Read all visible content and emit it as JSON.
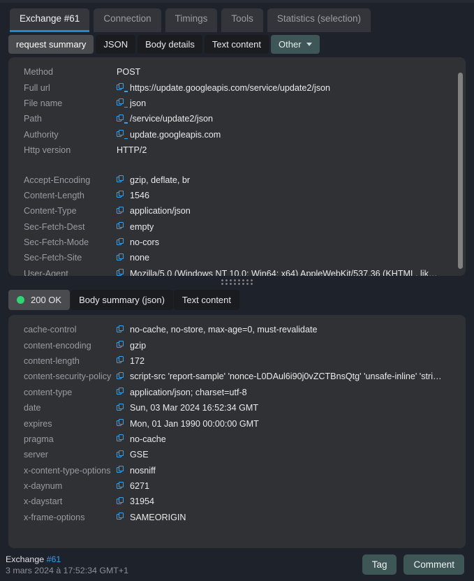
{
  "colors": {
    "background": "#1e232b",
    "panel": "#303134",
    "accent_blue": "#1f8ad0",
    "link_blue": "#3aa0e8",
    "teal_button": "#3e5656",
    "status_green": "#2fd573",
    "label_gray": "#9a9ca1"
  },
  "main_tabs": [
    {
      "label": "Exchange #61",
      "active": true
    },
    {
      "label": "Connection",
      "active": false
    },
    {
      "label": "Timings",
      "active": false
    },
    {
      "label": "Tools",
      "active": false
    },
    {
      "label": "Statistics (selection)",
      "active": false
    }
  ],
  "request_subtabs": [
    {
      "label": "request summary",
      "active": true
    },
    {
      "label": "JSON",
      "active": false
    },
    {
      "label": "Body details",
      "active": false
    },
    {
      "label": "Text content",
      "active": false
    }
  ],
  "request_other_dropdown": {
    "label": "Other",
    "icon": "chevron-down-icon"
  },
  "request_summary": {
    "groups": [
      {
        "rows": [
          {
            "key": "Method",
            "value": "POST",
            "copy": false,
            "link": false
          },
          {
            "key": "Full url",
            "value": "https://update.googleapis.com/service/update2/json",
            "copy": true,
            "link": true
          },
          {
            "key": "File name",
            "value": "json",
            "copy": true,
            "link": true
          },
          {
            "key": "Path",
            "value": "/service/update2/json",
            "copy": true,
            "link": true
          },
          {
            "key": "Authority",
            "value": "update.googleapis.com",
            "copy": true,
            "link": true
          },
          {
            "key": "Http version",
            "value": "HTTP/2",
            "copy": false,
            "link": false
          }
        ]
      },
      {
        "rows": [
          {
            "key": "Accept-Encoding",
            "value": "gzip, deflate, br",
            "copy": true,
            "link": false
          },
          {
            "key": "Content-Length",
            "value": "1546",
            "copy": true,
            "link": false
          },
          {
            "key": "Content-Type",
            "value": "application/json",
            "copy": true,
            "link": false
          },
          {
            "key": "Sec-Fetch-Dest",
            "value": "empty",
            "copy": true,
            "link": false
          },
          {
            "key": "Sec-Fetch-Mode",
            "value": "no-cors",
            "copy": true,
            "link": false
          },
          {
            "key": "Sec-Fetch-Site",
            "value": "none",
            "copy": true,
            "link": false
          },
          {
            "key": "User-Agent",
            "value": "Mozilla/5.0 (Windows NT 10.0; Win64; x64) AppleWebKit/537.36 (KHTML, lik…",
            "copy": true,
            "link": false
          }
        ]
      }
    ]
  },
  "splitter": {
    "icon": "drag-handle-dots-icon"
  },
  "response_tabs": [
    {
      "label": "200 OK",
      "active": true,
      "status_dot": true
    },
    {
      "label": "Body summary (json)",
      "active": false,
      "status_dot": false
    },
    {
      "label": "Text content",
      "active": false,
      "status_dot": false
    }
  ],
  "response_headers": {
    "rows": [
      {
        "key": "cache-control",
        "value": "no-cache, no-store, max-age=0, must-revalidate",
        "copy": true
      },
      {
        "key": "content-encoding",
        "value": "gzip",
        "copy": true
      },
      {
        "key": "content-length",
        "value": "172",
        "copy": true
      },
      {
        "key": "content-security-policy",
        "value": "script-src 'report-sample' 'nonce-L0DAul6i90j0vZCTBnsQtg' 'unsafe-inline' 'stri…",
        "copy": true
      },
      {
        "key": "content-type",
        "value": "application/json; charset=utf-8",
        "copy": true
      },
      {
        "key": "date",
        "value": "Sun, 03 Mar 2024 16:52:34 GMT",
        "copy": true
      },
      {
        "key": "expires",
        "value": "Mon, 01 Jan 1990 00:00:00 GMT",
        "copy": true
      },
      {
        "key": "pragma",
        "value": "no-cache",
        "copy": true
      },
      {
        "key": "server",
        "value": "GSE",
        "copy": true
      },
      {
        "key": "x-content-type-options",
        "value": "nosniff",
        "copy": true
      },
      {
        "key": "x-daynum",
        "value": "6271",
        "copy": true
      },
      {
        "key": "x-daystart",
        "value": "31954",
        "copy": true
      },
      {
        "key": "x-frame-options",
        "value": "SAMEORIGIN",
        "copy": true
      }
    ]
  },
  "footer": {
    "exchange_label": "Exchange ",
    "exchange_number": "#61",
    "timestamp": "3 mars 2024 à 17:52:34 GMT+1",
    "tag_button": "Tag",
    "comment_button": "Comment"
  }
}
